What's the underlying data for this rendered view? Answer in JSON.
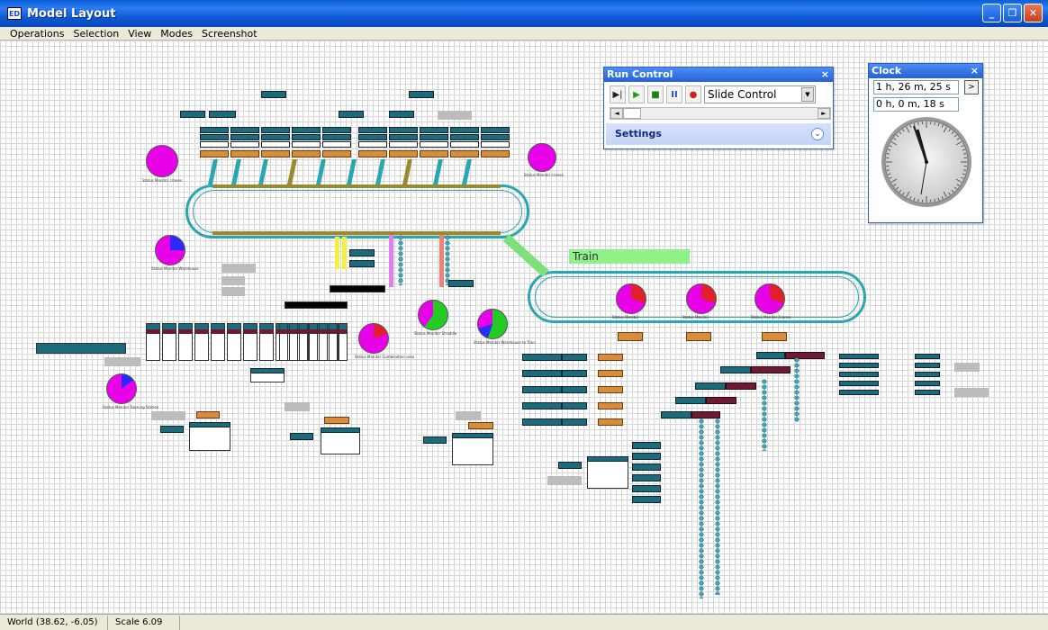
{
  "window": {
    "title": "Model Layout",
    "app_icon": "ED",
    "minimize": "_",
    "restore": "❐",
    "close": "✕"
  },
  "menu": [
    "Operations",
    "Selection",
    "View",
    "Modes",
    "Screenshot"
  ],
  "status": {
    "world": "World (38.62, -6.05)",
    "scale": "Scale 6.09"
  },
  "run_control": {
    "title": "Run Control",
    "close": "×",
    "buttons": {
      "step": "▶|",
      "play": "▶",
      "stop": "■",
      "pause": "II",
      "record": "●"
    },
    "mode_select": "Slide Control",
    "settings": "Settings",
    "scroll_left": "◄",
    "scroll_right": "►"
  },
  "clock": {
    "title": "Clock",
    "close": "×",
    "model_time": "1 h, 26 m, 25 s",
    "real_time": "0 h, 0 m, 18 s",
    "expand": ">"
  },
  "train_label": "Train",
  "monitors": [
    {
      "label": "Status Monitor cranes",
      "color": "#e800e8"
    },
    {
      "label": "Status Monitor cranes",
      "color": "#e800e8"
    },
    {
      "label": "Status Monitor Warehouse",
      "color": "#e800e8"
    },
    {
      "label": "Status Monitor",
      "color": "#e800e8"
    },
    {
      "label": "Status Monitor",
      "color": "#e800e8"
    },
    {
      "label": "Status Monitor Cranes",
      "color": "#e800e8"
    },
    {
      "label": "Status Monitor Straddle",
      "color": "#22cc22"
    },
    {
      "label": "Status Monitor Warehouse to Train",
      "color": "#22cc22"
    },
    {
      "label": "Status Monitor Combination area",
      "color": "#e800e8"
    },
    {
      "label": "Status Monitor Docking Station",
      "color": "#e800e8"
    }
  ],
  "colors": {
    "accent": "#0a5fd8",
    "track": "#2aa6b0",
    "teal": "#1d6b7a",
    "orange": "#d98c3a",
    "magenta": "#e800e8"
  }
}
